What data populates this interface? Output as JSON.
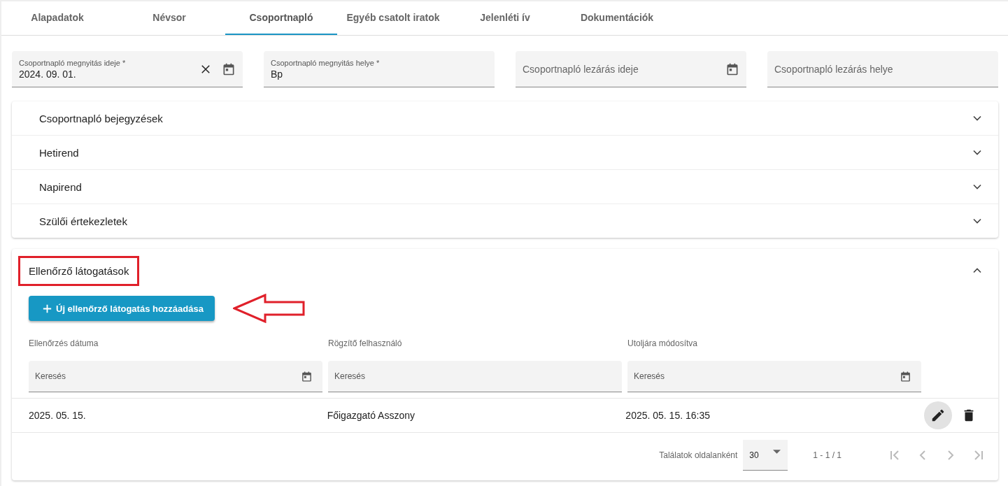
{
  "tabs": [
    {
      "label": "Alapadatok",
      "selected": false
    },
    {
      "label": "Névsor",
      "selected": false
    },
    {
      "label": "Csoportnapló",
      "selected": true
    },
    {
      "label": "Egyéb csatolt iratok",
      "selected": false
    },
    {
      "label": "Jelenléti ív",
      "selected": false
    },
    {
      "label": "Dokumentációk",
      "selected": false
    }
  ],
  "fields": [
    {
      "label": "Csoportnapló megnyitás ideje *",
      "value": "2024. 09. 01.",
      "kind": "date",
      "clearable": true
    },
    {
      "label": "Csoportnapló megnyitás helye *",
      "value": "Bp",
      "kind": "text",
      "clearable": false
    },
    {
      "placeholder": "Csoportnapló lezárás ideje",
      "kind": "date",
      "clearable": false
    },
    {
      "placeholder": "Csoportnapló lezárás helye",
      "kind": "text",
      "clearable": false
    }
  ],
  "panels": [
    {
      "title": "Csoportnapló bejegyzések",
      "expanded": false,
      "highlighted": false
    },
    {
      "title": "Hetirend",
      "expanded": false,
      "highlighted": false
    },
    {
      "title": "Napirend",
      "expanded": false,
      "highlighted": false
    },
    {
      "title": "Szülői értekezletek",
      "expanded": false,
      "highlighted": false
    }
  ],
  "visits": {
    "title": "Ellenőrző látogatások",
    "expanded": true,
    "highlighted": true,
    "add_button": "Új ellenőrző látogatás hozzáadása",
    "arrow_annotation": true,
    "columns": [
      {
        "label": "Ellenőrzés dátuma",
        "placeholder": "Keresés",
        "kind": "date"
      },
      {
        "label": "Rögzítő felhasználó",
        "placeholder": "Keresés",
        "kind": "text"
      },
      {
        "label": "Utoljára módosítva",
        "placeholder": "Keresés",
        "kind": "date"
      }
    ],
    "rows": [
      {
        "cells": [
          "2025. 05. 15.",
          "Főigazgató Asszony",
          "2025. 05. 15. 16:35"
        ]
      }
    ],
    "paginator": {
      "label": "Találatok oldalanként",
      "page_size": "30",
      "range": "1 - 1 / 1"
    }
  }
}
